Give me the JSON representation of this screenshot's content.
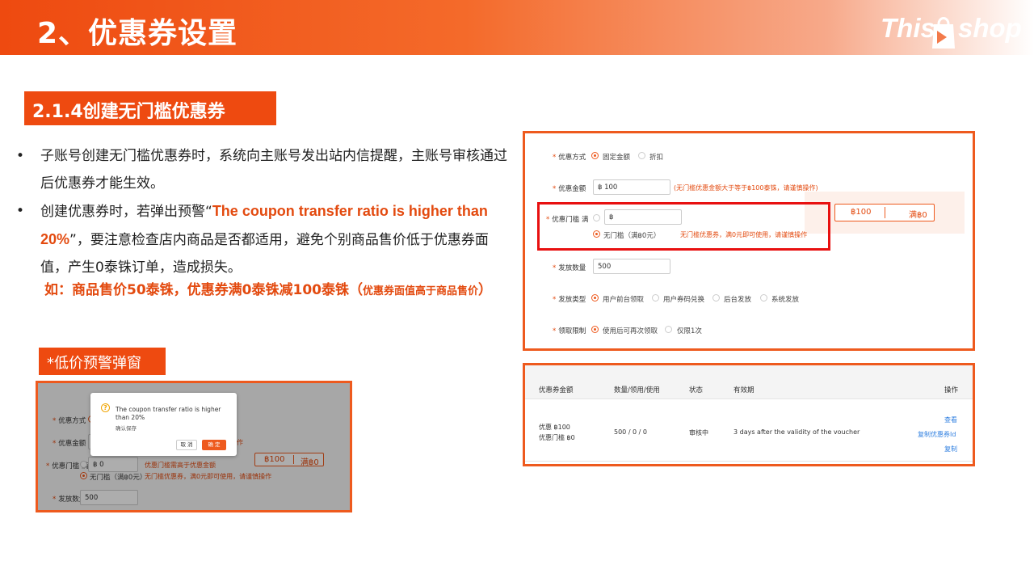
{
  "header": {
    "title": "2、优惠券设置",
    "logo_left": "This",
    "logo_right": "shop"
  },
  "section_title": "2.1.4创建无门槛优惠券",
  "bullets": [
    {
      "text": "子账号创建无门槛优惠券时，系统向主账号发出站内信提醒，主账号审核通过后优惠券才能生效。"
    },
    {
      "pre": "创建优惠券时，若弹出预警“",
      "highlight": "The coupon transfer ratio is higher than 20%",
      "post": "”，要注意检查店内商品是否都适用，避免个别商品售价低于优惠券面值，产生0泰铢订单，造成损失。"
    }
  ],
  "example": {
    "main": "如：商品售价50泰铢，优惠券满0泰铢减100泰铢（",
    "note": "优惠券面值高于商品售价",
    "close": "）"
  },
  "warning_tag": "*低价预警弹窗",
  "popup": {
    "message": "The coupon transfer ratio is higher than 20%",
    "sub": "确认保存",
    "cancel": "取 消",
    "confirm": "确 定",
    "bg_form": {
      "method_label": "优惠方式",
      "method_value": "固",
      "amount_label": "优惠金额",
      "amount_value": "฿ 1",
      "threshold_label": "优惠门槛 满",
      "threshold_value": "฿ 0",
      "threshold_hint": "优惠门槛需高于优惠金额",
      "threshold_hint_tail": "作",
      "no_threshold": "无门槛（满฿0元）",
      "no_threshold_hint": "无门槛优惠券，满0元即可使用，请谨慎操作",
      "qty_label": "发放数量",
      "qty_value": "500",
      "preview_left": "฿100",
      "preview_right": "满฿0"
    }
  },
  "form": {
    "method_label": "优惠方式",
    "method_options": [
      "固定金额",
      "折扣"
    ],
    "amount_label": "优惠金额",
    "amount_value": "฿ 100",
    "amount_hint": "(无门槛优惠金额大于等于฿100泰铢，请谨慎操作)",
    "threshold_label": "优惠门槛 满",
    "threshold_value": "฿",
    "no_threshold": "无门槛（满฿0元）",
    "no_threshold_hint": "无门槛优惠券，满0元即可使用，请谨慎操作",
    "preview_left": "฿100",
    "preview_right": "满฿0",
    "qty_label": "发放数量",
    "qty_value": "500",
    "issue_label": "发放类型",
    "issue_options": [
      "用户前台领取",
      "用户券码兑换",
      "后台发放",
      "系统发放"
    ],
    "limit_label": "领取限制",
    "limit_options": [
      "使用后可再次领取",
      "仅限1次"
    ]
  },
  "table": {
    "headers": [
      "优惠券金额",
      "数量/领用/使用",
      "状态",
      "有效期",
      "操作"
    ],
    "row": {
      "amount_line1": "优惠 ฿100",
      "amount_line2": "优惠门槛 ฿0",
      "counts": "500 / 0 / 0",
      "status": "审核中",
      "validity": "3 days after the validity of the voucher",
      "actions": [
        "查看",
        "复制优惠券Id",
        "复制"
      ]
    }
  }
}
